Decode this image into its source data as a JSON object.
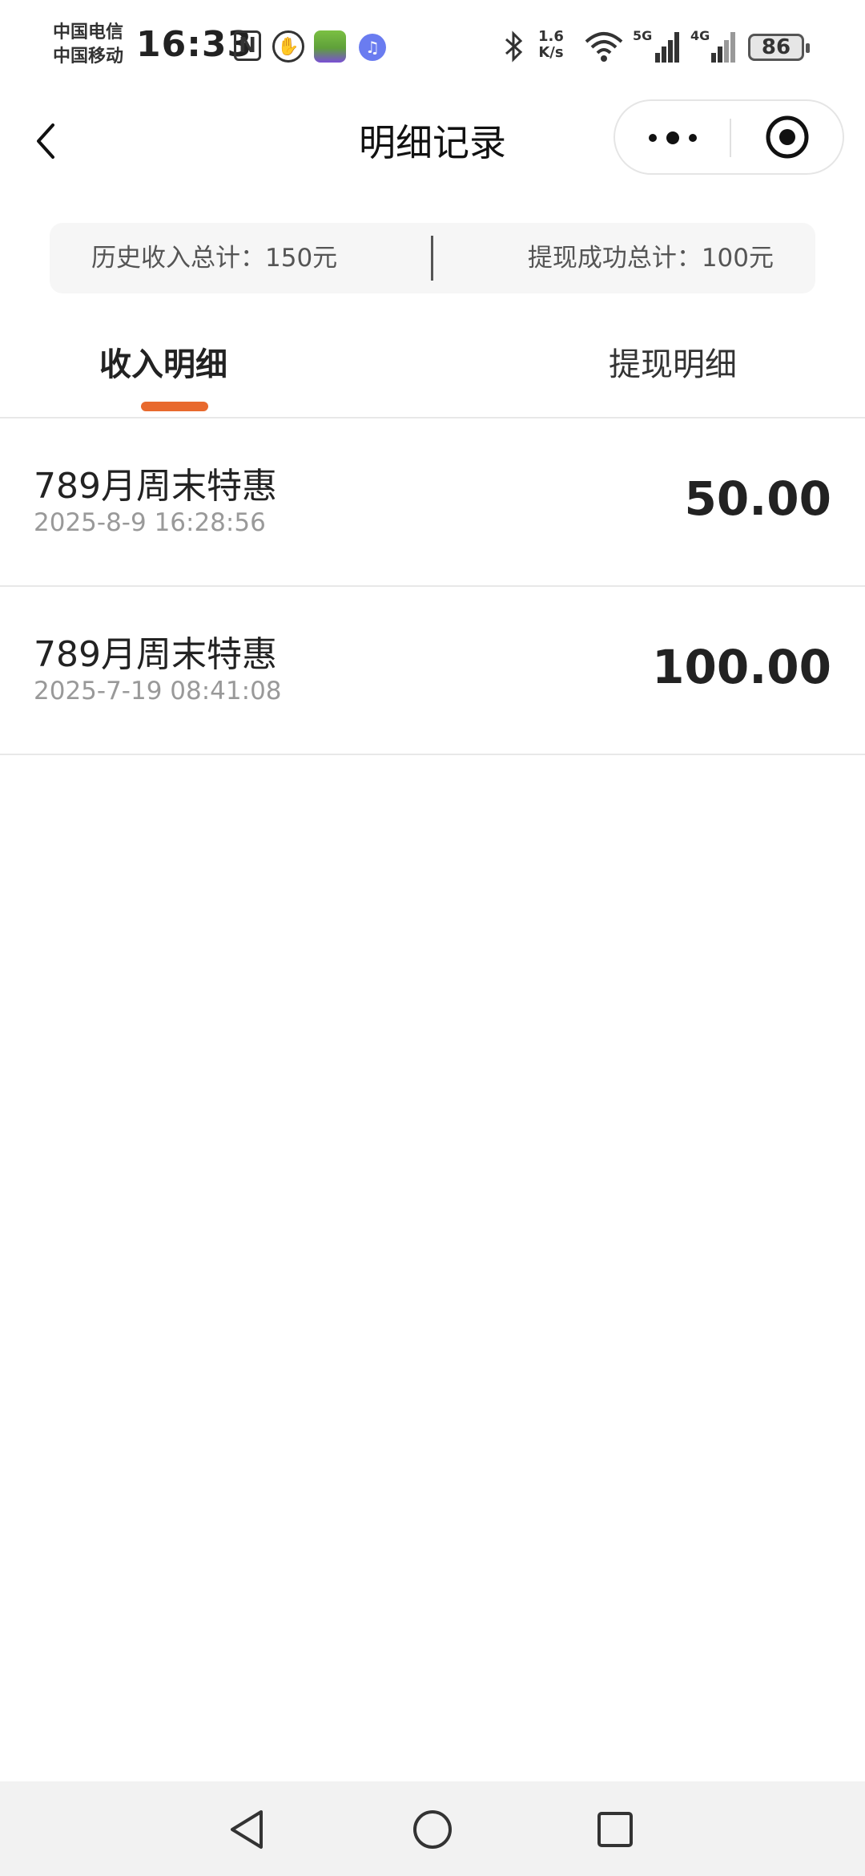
{
  "status_bar": {
    "carrier_1": "中国电信",
    "carrier_2": "中国移动",
    "time": "16:33",
    "net_speed_value": "1.6",
    "net_speed_unit": "K/s",
    "signal_1_label": "5G",
    "signal_2_label": "4G",
    "battery": "86",
    "icons": [
      "nfc-icon",
      "hand-icon",
      "game-app-icon",
      "music-icon",
      "bluetooth-icon",
      "wifi-icon",
      "signal-5g-icon",
      "signal-4g-icon",
      "battery-icon"
    ]
  },
  "nav": {
    "title": "明细记录"
  },
  "summary": {
    "income_total": "历史收入总计：150元",
    "withdraw_total": "提现成功总计：100元"
  },
  "tabs": [
    {
      "label": "收入明细",
      "active": true
    },
    {
      "label": "提现明细",
      "active": false
    }
  ],
  "records": [
    {
      "title": "789月周末特惠",
      "time": "2025-8-9 16:28:56",
      "amount": "50.00"
    },
    {
      "title": "789月周末特惠",
      "time": "2025-7-19 08:41:08",
      "amount": "100.00"
    }
  ],
  "colors": {
    "accent": "#e8692d",
    "text_primary": "#222222",
    "text_secondary": "#999999",
    "summary_bg": "#f6f6f6"
  }
}
